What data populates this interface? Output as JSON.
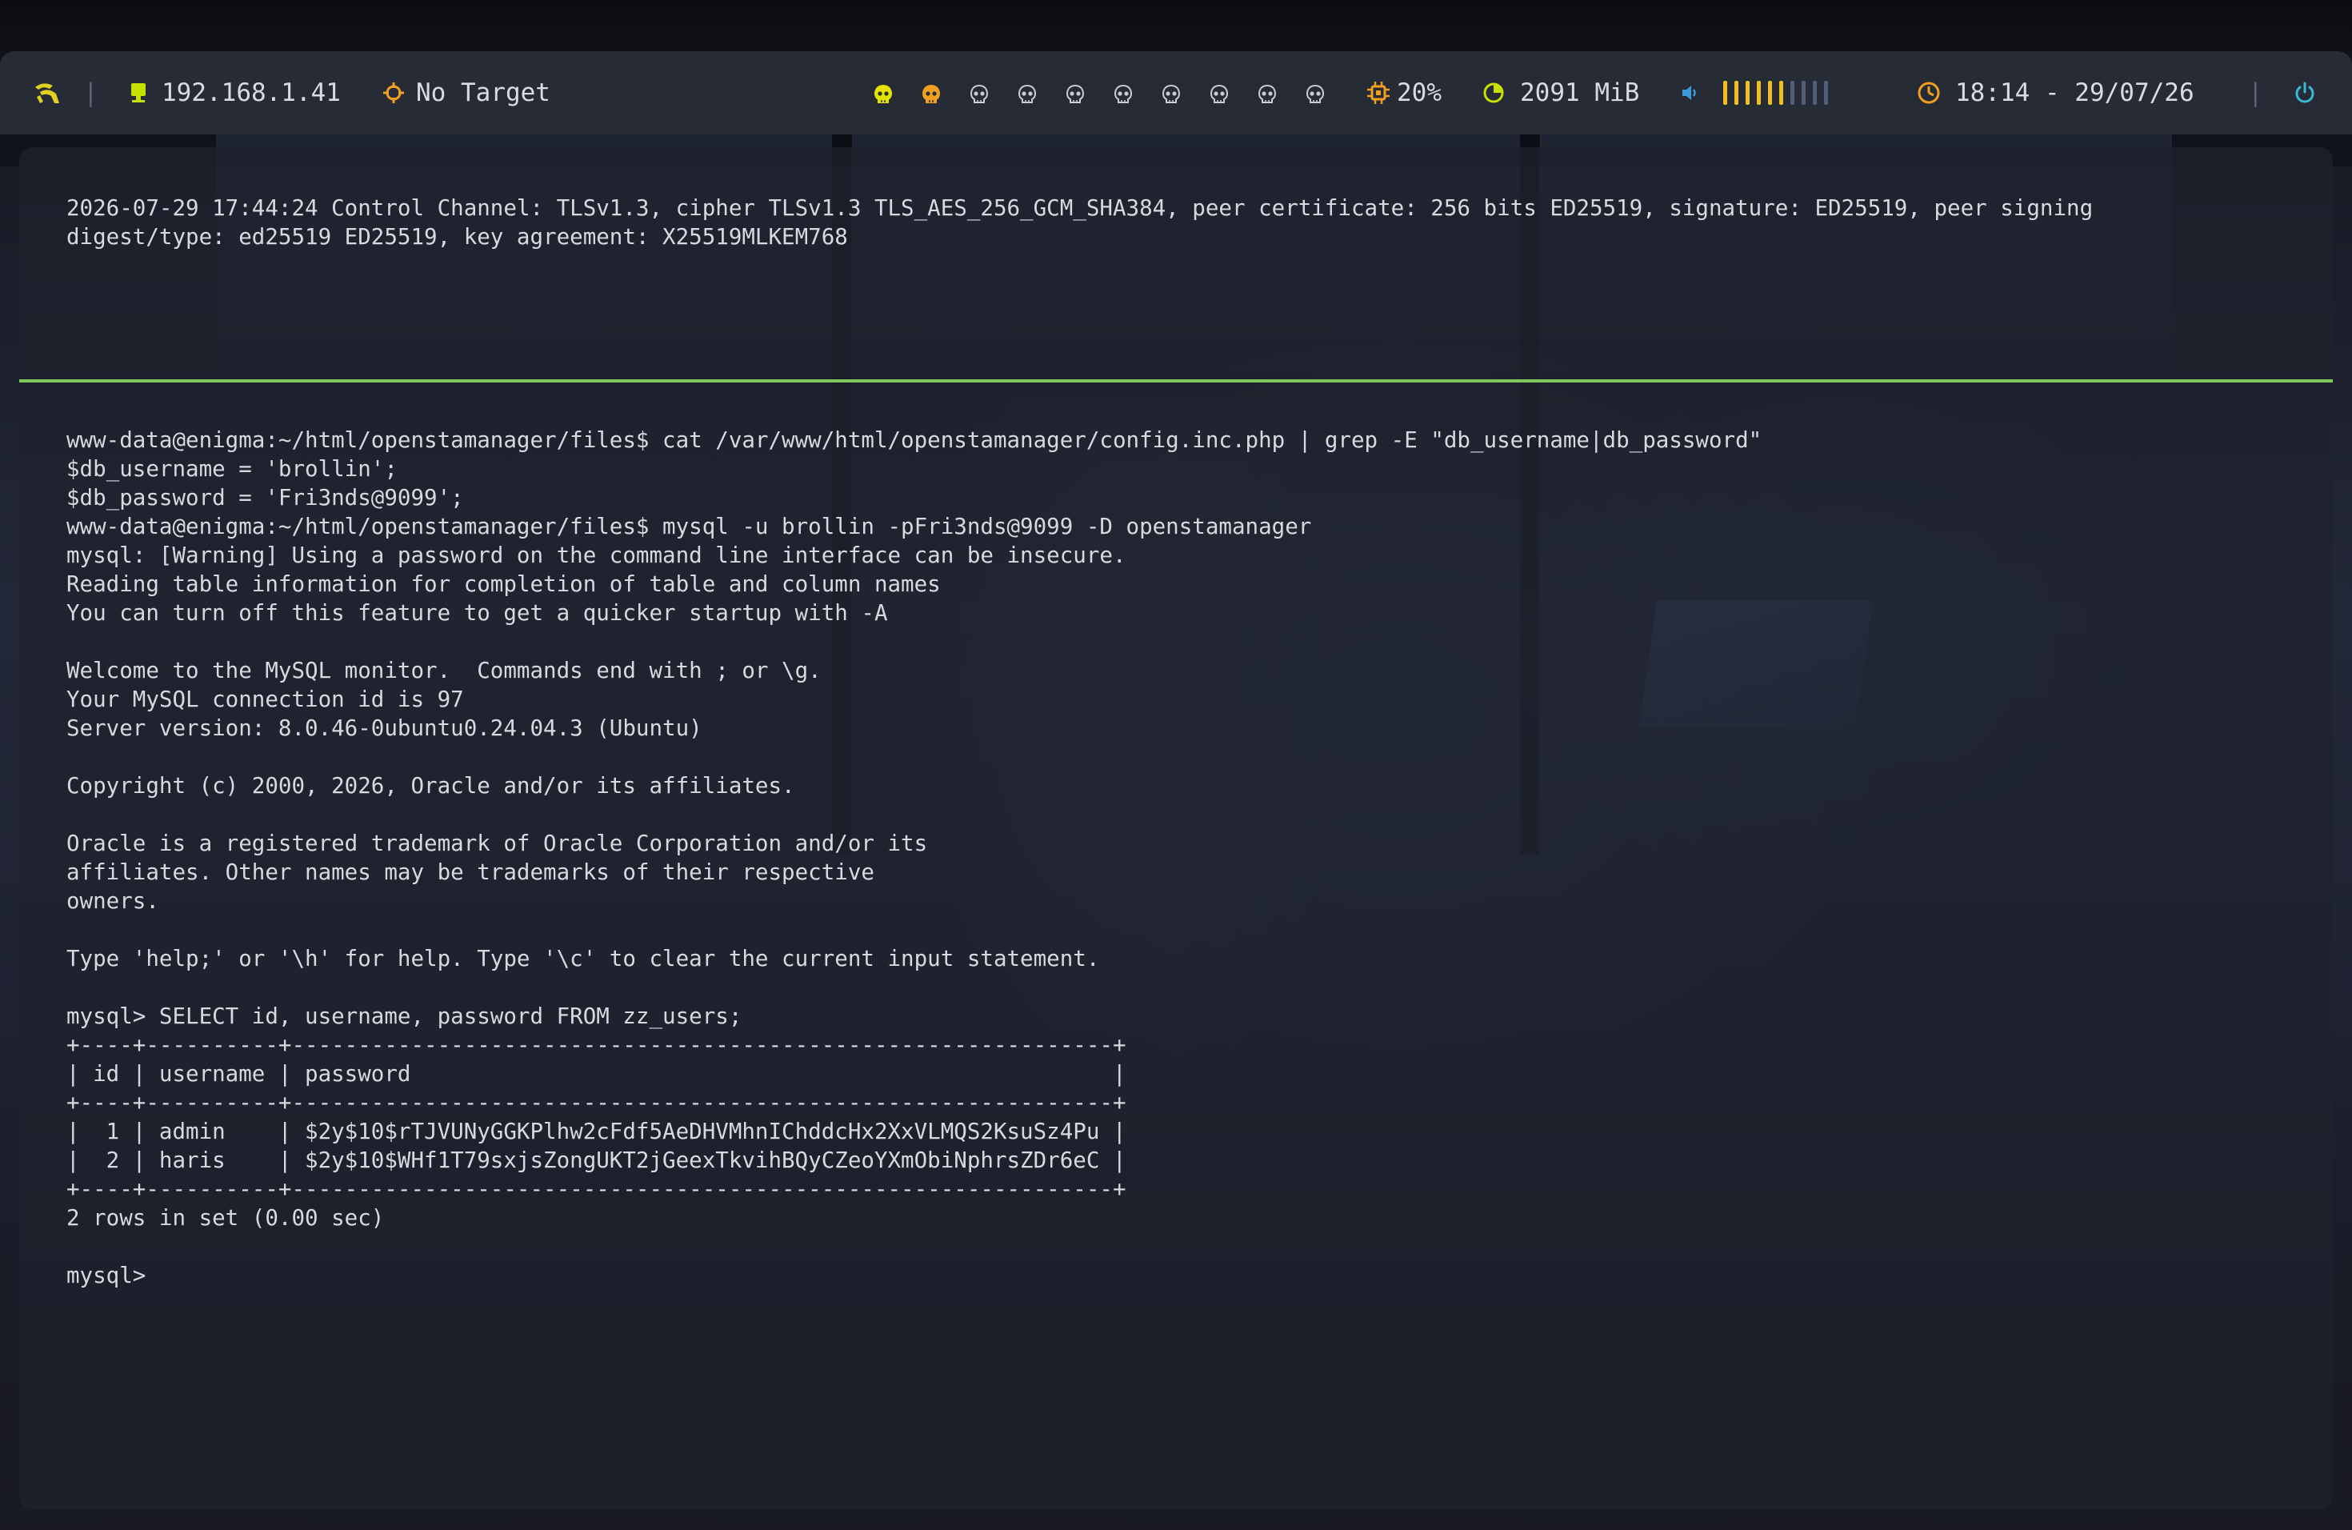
{
  "topbar": {
    "ip": "192.168.1.41",
    "target": "No Target",
    "cpu": "20%",
    "memory": "2091 MiB",
    "clock": "18:14 - 29/07/26",
    "separator": "|",
    "workspaces": [
      {
        "color": "#e4e000",
        "filled": true
      },
      {
        "color": "#f0a020",
        "filled": true
      },
      {
        "color": "#c8ccd4",
        "filled": false
      },
      {
        "color": "#c8ccd4",
        "filled": false
      },
      {
        "color": "#c8ccd4",
        "filled": false
      },
      {
        "color": "#c8ccd4",
        "filled": false
      },
      {
        "color": "#c8ccd4",
        "filled": false
      },
      {
        "color": "#c8ccd4",
        "filled": false
      },
      {
        "color": "#c8ccd4",
        "filled": false
      },
      {
        "color": "#c8ccd4",
        "filled": false
      }
    ],
    "volume_level": 0.6,
    "volume_segments": 10,
    "colors": {
      "ip_icon": "#c8e000",
      "target_icon": "#f0a020",
      "cpu_icon": "#f0a020",
      "memory_icon": "#c8e000",
      "volume_icon": "#3a9ad8",
      "volume_active": "#f0c020",
      "volume_inactive": "#4f5f7a",
      "clock_icon": "#f0a020",
      "power_icon": "#3ab8d8",
      "arch_icon": "#e0d020"
    }
  },
  "terminal": {
    "top_pane": [
      "2026-07-29 17:44:24 Control Channel: TLSv1.3, cipher TLSv1.3 TLS_AES_256_GCM_SHA384, peer certificate: 256 bits ED25519, signature: ED25519, peer signing",
      "digest/type: ed25519 ED25519, key agreement: X25519MLKEM768"
    ],
    "bottom_pane": [
      "www-data@enigma:~/html/openstamanager/files$ cat /var/www/html/openstamanager/config.inc.php | grep -E \"db_username|db_password\"",
      "$db_username = 'brollin';",
      "$db_password = 'Fri3nds@9099';",
      "www-data@enigma:~/html/openstamanager/files$ mysql -u brollin -pFri3nds@9099 -D openstamanager",
      "mysql: [Warning] Using a password on the command line interface can be insecure.",
      "Reading table information for completion of table and column names",
      "You can turn off this feature to get a quicker startup with -A",
      "",
      "Welcome to the MySQL monitor.  Commands end with ; or \\g.",
      "Your MySQL connection id is 97",
      "Server version: 8.0.46-0ubuntu0.24.04.3 (Ubuntu)",
      "",
      "Copyright (c) 2000, 2026, Oracle and/or its affiliates.",
      "",
      "Oracle is a registered trademark of Oracle Corporation and/or its",
      "affiliates. Other names may be trademarks of their respective",
      "owners.",
      "",
      "Type 'help;' or '\\h' for help. Type '\\c' to clear the current input statement.",
      "",
      "mysql> SELECT id, username, password FROM zz_users;",
      "+----+----------+--------------------------------------------------------------+",
      "| id | username | password                                                     |",
      "+----+----------+--------------------------------------------------------------+",
      "|  1 | admin    | $2y$10$rTJVUNyGGKPlhw2cFdf5AeDHVMhnIChddcHx2XxVLMQS2KsuSz4Pu |",
      "|  2 | haris    | $2y$10$WHf1T79sxjsZongUKT2jGeexTkvihBQyCZeoYXmObiNphrsZDr6eC |",
      "+----+----------+--------------------------------------------------------------+",
      "2 rows in set (0.00 sec)",
      "",
      "mysql> "
    ],
    "colors": {
      "text": "#d6d9de",
      "divider": "#7fc85a"
    }
  }
}
